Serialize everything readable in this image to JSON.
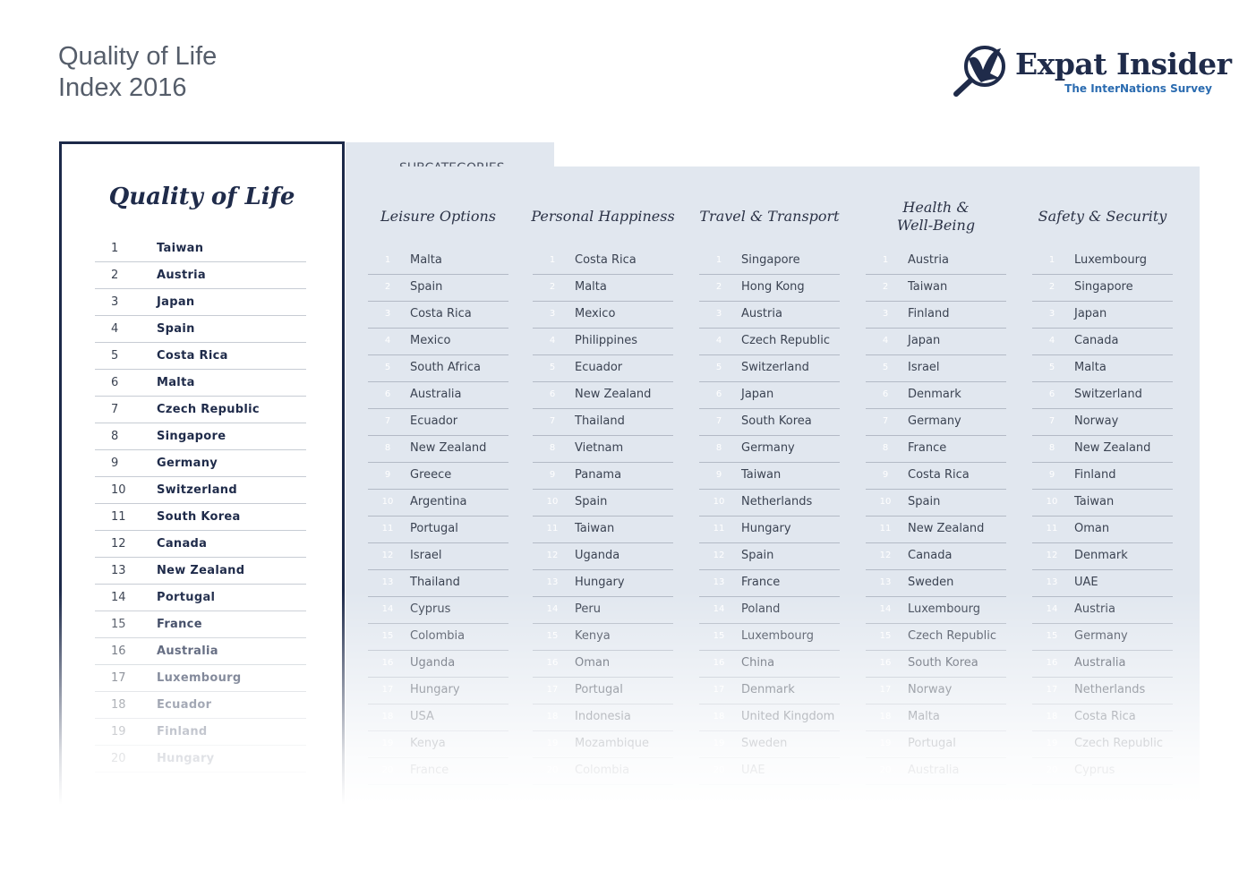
{
  "header": {
    "title_line1": "Quality of Life",
    "title_line2": "Index 2016"
  },
  "logo": {
    "name": "Expat Insider",
    "tagline": "The InterNations Survey",
    "icon": "magnifier-bird-icon"
  },
  "colors": {
    "navy": "#1c2949",
    "panel": "#e1e7ef",
    "accent": "#2a6bb0"
  },
  "main_ranking": {
    "title": "Quality of Life",
    "items": [
      {
        "rank": "1",
        "country": "Taiwan"
      },
      {
        "rank": "2",
        "country": "Austria"
      },
      {
        "rank": "3",
        "country": "Japan"
      },
      {
        "rank": "4",
        "country": "Spain"
      },
      {
        "rank": "5",
        "country": "Costa Rica"
      },
      {
        "rank": "6",
        "country": "Malta"
      },
      {
        "rank": "7",
        "country": "Czech Republic"
      },
      {
        "rank": "8",
        "country": "Singapore"
      },
      {
        "rank": "9",
        "country": "Germany"
      },
      {
        "rank": "10",
        "country": "Switzerland"
      },
      {
        "rank": "11",
        "country": "South Korea"
      },
      {
        "rank": "12",
        "country": "Canada"
      },
      {
        "rank": "13",
        "country": "New Zealand"
      },
      {
        "rank": "14",
        "country": "Portugal"
      },
      {
        "rank": "15",
        "country": "France"
      },
      {
        "rank": "16",
        "country": "Australia"
      },
      {
        "rank": "17",
        "country": "Luxembourg"
      },
      {
        "rank": "18",
        "country": "Ecuador"
      },
      {
        "rank": "19",
        "country": "Finland"
      },
      {
        "rank": "20",
        "country": "Hungary"
      }
    ]
  },
  "subcategories_label": "SUBCATEGORIES",
  "subcategories": [
    {
      "title": "Leisure Options",
      "items": [
        "Malta",
        "Spain",
        "Costa Rica",
        "Mexico",
        "South Africa",
        "Australia",
        "Ecuador",
        "New Zealand",
        "Greece",
        "Argentina",
        "Portugal",
        "Israel",
        "Thailand",
        "Cyprus",
        "Colombia",
        "Uganda",
        "Hungary",
        "USA",
        "Kenya",
        "France"
      ]
    },
    {
      "title": "Personal Happiness",
      "items": [
        "Costa Rica",
        "Malta",
        "Mexico",
        "Philippines",
        "Ecuador",
        "New Zealand",
        "Thailand",
        "Vietnam",
        "Panama",
        "Spain",
        "Taiwan",
        "Uganda",
        "Hungary",
        "Peru",
        "Kenya",
        "Oman",
        "Portugal",
        "Indonesia",
        "Mozambique",
        "Colombia"
      ]
    },
    {
      "title": "Travel & Transport",
      "items": [
        "Singapore",
        "Hong Kong",
        "Austria",
        "Czech Republic",
        "Switzerland",
        "Japan",
        "South Korea",
        "Germany",
        "Taiwan",
        "Netherlands",
        "Hungary",
        "Spain",
        "France",
        "Poland",
        "Luxembourg",
        "China",
        "Denmark",
        "United Kingdom",
        "Sweden",
        "UAE"
      ]
    },
    {
      "title": "Health & Well-Being",
      "title_line1": "Health &",
      "title_line2": "Well-Being",
      "items": [
        "Austria",
        "Taiwan",
        "Finland",
        "Japan",
        "Israel",
        "Denmark",
        "Germany",
        "France",
        "Costa Rica",
        "Spain",
        "New Zealand",
        "Canada",
        "Sweden",
        "Luxembourg",
        "Czech Republic",
        "South Korea",
        "Norway",
        "Malta",
        "Portugal",
        "Australia"
      ]
    },
    {
      "title": "Safety & Security",
      "items": [
        "Luxembourg",
        "Singapore",
        "Japan",
        "Canada",
        "Malta",
        "Switzerland",
        "Norway",
        "New Zealand",
        "Finland",
        "Taiwan",
        "Oman",
        "Denmark",
        "UAE",
        "Austria",
        "Germany",
        "Australia",
        "Netherlands",
        "Costa Rica",
        "Czech Republic",
        "Cyprus"
      ]
    }
  ]
}
